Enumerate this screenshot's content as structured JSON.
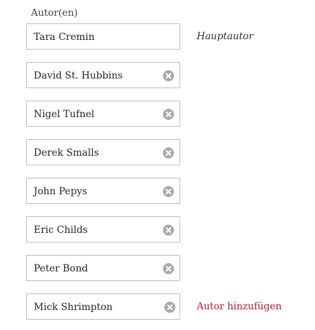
{
  "authors_label": "Autor(en)",
  "primary_author_hint": "Hauptautor",
  "add_author_label": "Autor hinzufügen",
  "authors": [
    {
      "name": "Tara Cremin"
    },
    {
      "name": "David St. Hubbins"
    },
    {
      "name": "Nigel Tufnel"
    },
    {
      "name": "Derek Smalls"
    },
    {
      "name": "John Pepys"
    },
    {
      "name": "Eric Childs"
    },
    {
      "name": "Peter Bond"
    },
    {
      "name": "Mick Shrimpton"
    }
  ],
  "colors": {
    "field_border": "#bdbdbd",
    "remove_icon": "#a9a9a9",
    "add_link": "#b01c2e"
  },
  "icons": {
    "remove": "remove-circle-x-icon"
  }
}
